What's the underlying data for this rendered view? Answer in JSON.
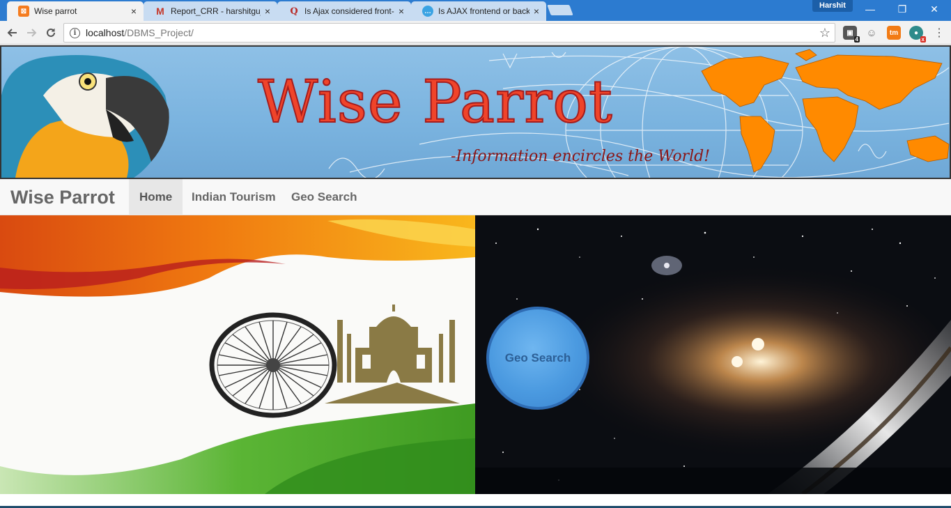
{
  "browser": {
    "tabs": [
      {
        "title": "Wise parrot",
        "close": "×",
        "favicon": "xampp-icon"
      },
      {
        "title": "Report_CRR - harshitguj",
        "close": "×",
        "favicon": "gmail-icon"
      },
      {
        "title": "Is Ajax considered front-",
        "close": "×",
        "favicon": "quora-icon"
      },
      {
        "title": "Is AJAX frontend or back",
        "close": "×",
        "favicon": "chat-icon"
      }
    ],
    "profile_name": "Harshit",
    "window_controls": {
      "minimize": "—",
      "restore": "❐",
      "close": "✕"
    },
    "address": {
      "host": "localhost",
      "path": "/DBMS_Project/"
    },
    "extensions": [
      {
        "name": "extension-icon-1",
        "badge": "4"
      },
      {
        "name": "extension-icon-2",
        "badge": ""
      },
      {
        "name": "extension-icon-3",
        "label": "tm",
        "badge": ""
      },
      {
        "name": "extension-icon-4",
        "badge": "x"
      }
    ]
  },
  "banner": {
    "title": "Wise Parrot",
    "tagline": "-Information encircles the World!"
  },
  "navbar": {
    "brand": "Wise Parrot",
    "items": [
      {
        "label": "Home",
        "active": true
      },
      {
        "label": "Indian Tourism",
        "active": false
      },
      {
        "label": "Geo Search",
        "active": false
      }
    ]
  },
  "panels": {
    "geo_button_label": "Geo Search"
  },
  "colors": {
    "tabbar": "#2c7bd0",
    "banner_sky": "#7ab3df",
    "title_red": "#f0442a",
    "world_map": "#ff8a00",
    "geo_button": "#4b9ae0"
  }
}
